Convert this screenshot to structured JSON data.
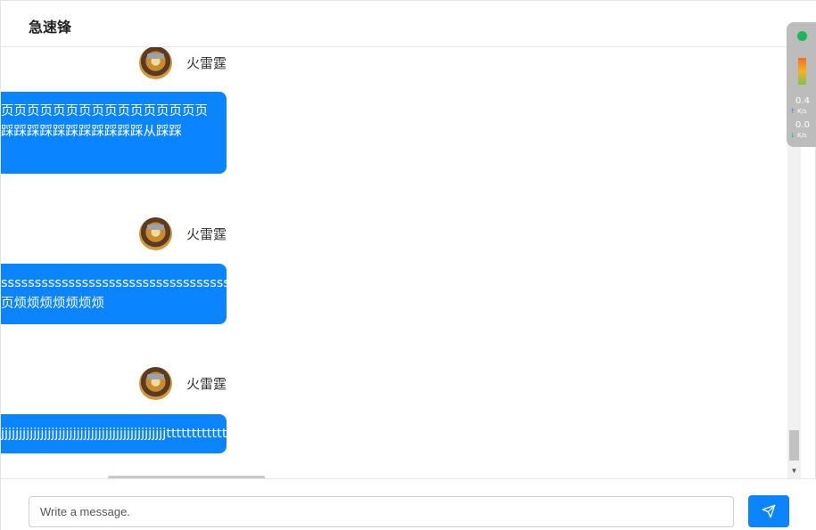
{
  "header": {
    "title": "急速锋"
  },
  "messages": [
    {
      "sender": "火雷霆",
      "lines": [
        "页页页页页页页页页页页页页页页页",
        "踩踩踩踩踩踩踩踩踩踩踩从踩踩",
        ""
      ]
    },
    {
      "sender": "火雷霆",
      "lines": [
        "ssssssssssssssssssssssssssssssssssssssssss",
        "页烦烦烦烦烦烦烦"
      ]
    },
    {
      "sender": "火雷霆",
      "lines": [
        "jjjjjjjjjjjjjjjjjjjjjjjjjjjjjjjjjjjjjjjjjjjjjjtttttttttttttt"
      ]
    }
  ],
  "composer": {
    "placeholder": "Write a message."
  },
  "net_monitor": {
    "status_color": "#18b85d",
    "upload_value": "0.4",
    "upload_unit": "K/s",
    "download_value": "0.0",
    "download_unit": "K/s"
  },
  "colors": {
    "accent": "#0a84ff"
  }
}
